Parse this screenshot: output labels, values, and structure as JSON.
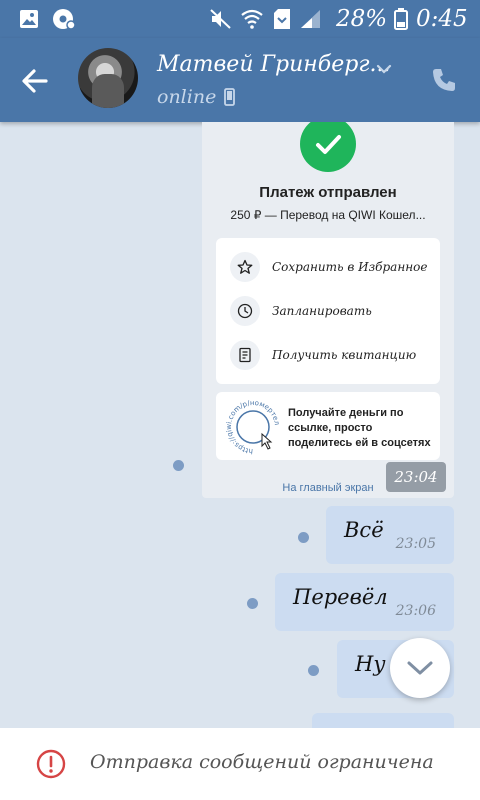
{
  "status_bar": {
    "battery_percent": "28%",
    "time": "0:45",
    "icons": [
      "gallery-icon",
      "gear-notification-icon",
      "mute-icon",
      "wifi-icon",
      "sim-icon",
      "signal-icon",
      "battery-icon"
    ]
  },
  "header": {
    "contact_name": "Матвей Гринберг...",
    "status": "online",
    "icons": [
      "back-arrow-icon",
      "chevron-down-icon",
      "mobile-icon",
      "phone-icon"
    ]
  },
  "chat": {
    "payment_card": {
      "title": "Платеж отправлен",
      "subtitle": "250 ₽ — Перевод на QIWI Кошел...",
      "options": [
        {
          "label": "Сохранить в Избранное",
          "icon": "star-icon"
        },
        {
          "label": "Запланировать",
          "icon": "clock-icon"
        },
        {
          "label": "Получить квитанцию",
          "icon": "receipt-icon"
        }
      ],
      "promo_text": "Получайте деньги по ссылке, просто поделитесь ей в соцсетях",
      "promo_graphic_text": "https://qiwi.com/p/номертелефона",
      "link_text": "На главный экран",
      "time": "23:04"
    },
    "messages": [
      {
        "text": "Всё",
        "time": "23:05"
      },
      {
        "text": "Перевёл",
        "time": "23:06"
      },
      {
        "text": "Ну",
        "time": ""
      }
    ]
  },
  "notice": {
    "text": "Отправка сообщений ограничена",
    "icon": "alert-icon"
  },
  "colors": {
    "header": "#4a76a8",
    "chat_background": "#dbe4ee",
    "outgoing_bubble": "#ccdcf1",
    "success": "#1fb55b",
    "alert": "#d64545"
  }
}
